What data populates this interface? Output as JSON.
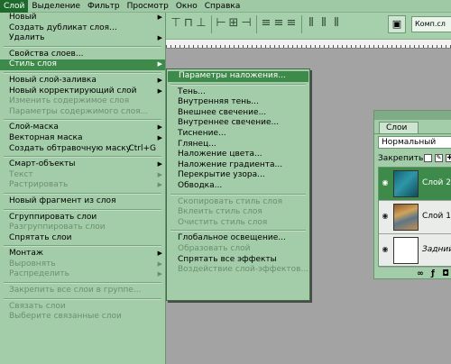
{
  "menubar": {
    "items": [
      {
        "label": "Слой",
        "active": true
      },
      {
        "label": "Выделение"
      },
      {
        "label": "Фильтр"
      },
      {
        "label": "Просмотр"
      },
      {
        "label": "Окно"
      },
      {
        "label": "Справка"
      }
    ]
  },
  "options_bar": {
    "comp_label": "Комп.сл"
  },
  "layer_menu": {
    "items": [
      {
        "label": "Новый",
        "arrow": true
      },
      {
        "label": "Создать дубликат слоя..."
      },
      {
        "label": "Удалить",
        "arrow": true
      },
      {
        "sep": true
      },
      {
        "label": "Свойства слоев..."
      },
      {
        "label": "Стиль слоя",
        "arrow": true,
        "highlight": true
      },
      {
        "sep": true
      },
      {
        "label": "Новый слой-заливка",
        "arrow": true
      },
      {
        "label": "Новый корректирующий слой",
        "arrow": true
      },
      {
        "label": "Изменить содержимое слоя",
        "disabled": true
      },
      {
        "label": "Параметры содержимого слоя...",
        "disabled": true
      },
      {
        "sep": true
      },
      {
        "label": "Слой-маска",
        "arrow": true
      },
      {
        "label": "Векторная маска",
        "arrow": true
      },
      {
        "label": "Создать обтравочную маску",
        "shortcut": "Ctrl+G"
      },
      {
        "sep": true
      },
      {
        "label": "Смарт-объекты",
        "arrow": true
      },
      {
        "label": "Текст",
        "arrow": true,
        "disabled": true
      },
      {
        "label": "Растрировать",
        "arrow": true,
        "disabled": true
      },
      {
        "sep": true
      },
      {
        "label": "Новый фрагмент из слоя"
      },
      {
        "sep": true
      },
      {
        "label": "Сгруппировать слои"
      },
      {
        "label": "Разгруппировать слои",
        "disabled": true
      },
      {
        "label": "Спрятать слои"
      },
      {
        "sep": true
      },
      {
        "label": "Монтаж",
        "arrow": true
      },
      {
        "label": "Выровнять",
        "arrow": true,
        "disabled": true
      },
      {
        "label": "Распределить",
        "arrow": true,
        "disabled": true
      },
      {
        "sep": true
      },
      {
        "label": "Закрепить все слои в группе...",
        "disabled": true
      },
      {
        "sep": true
      },
      {
        "label": "Связать слои",
        "disabled": true
      },
      {
        "label": "Выберите связанные слои",
        "disabled": true
      }
    ]
  },
  "style_submenu": {
    "items": [
      {
        "label": "Параметры наложения...",
        "highlight": true
      },
      {
        "sep": true
      },
      {
        "label": "Тень..."
      },
      {
        "label": "Внутренняя тень..."
      },
      {
        "label": "Внешнее свечение..."
      },
      {
        "label": "Внутреннее свечение..."
      },
      {
        "label": "Тиснение..."
      },
      {
        "label": "Глянец..."
      },
      {
        "label": "Наложение цвета..."
      },
      {
        "label": "Наложение градиента..."
      },
      {
        "label": "Перекрытие узора..."
      },
      {
        "label": "Обводка..."
      },
      {
        "sep": true
      },
      {
        "label": "Скопировать стиль слоя",
        "disabled": true
      },
      {
        "label": "Вклеить стиль слоя",
        "disabled": true
      },
      {
        "label": "Очистить стиль слоя",
        "disabled": true
      },
      {
        "sep": true
      },
      {
        "label": "Глобальное освещение..."
      },
      {
        "label": "Образовать слой",
        "disabled": true
      },
      {
        "label": "Спрятать все эффекты"
      },
      {
        "label": "Воздействие слой-эффектов...",
        "disabled": true
      }
    ]
  },
  "layers_panel": {
    "tab": "Слои",
    "blend_mode": "Нормальный",
    "lock_label": "Закрепить:",
    "layers": [
      {
        "name": "Слой 2",
        "selected": true,
        "thumb": "t1"
      },
      {
        "name": "Слой 1",
        "thumb": "t2"
      },
      {
        "name": "Задний пл",
        "italic": true,
        "thumb": "t3"
      }
    ]
  },
  "colors": {
    "menu_bg": "#a3cca9",
    "highlight": "#3e8a4b",
    "disabled_text": "#6c8f72",
    "workspace": "#a3a3a3"
  }
}
